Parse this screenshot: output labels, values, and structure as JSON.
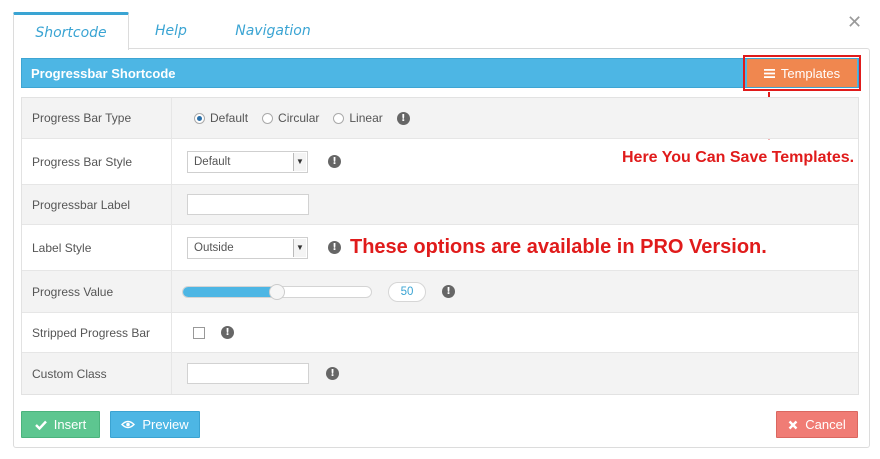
{
  "tabs": [
    {
      "label": "Shortcode",
      "active": true
    },
    {
      "label": "Help",
      "active": false
    },
    {
      "label": "Navigation",
      "active": false
    }
  ],
  "close_glyph": "✕",
  "header": {
    "title": "Progressbar Shortcode",
    "templates_label": "Templates"
  },
  "annotations": {
    "templates_note": "Here You Can Save Templates.",
    "pro_note": "These options are available in PRO Version."
  },
  "fields": {
    "type": {
      "label": "Progress Bar Type",
      "options": [
        "Default",
        "Circular",
        "Linear"
      ],
      "selected": "Default"
    },
    "style": {
      "label": "Progress Bar Style",
      "value": "Default"
    },
    "label": {
      "label": "Progressbar Label",
      "value": ""
    },
    "label_style": {
      "label": "Label Style",
      "value": "Outside"
    },
    "progress_value": {
      "label": "Progress Value",
      "value": "50",
      "fraction": 0.5
    },
    "striped": {
      "label": "Stripped Progress Bar",
      "checked": false
    },
    "custom_class": {
      "label": "Custom Class",
      "value": ""
    }
  },
  "buttons": {
    "insert": "Insert",
    "preview": "Preview",
    "cancel": "Cancel"
  },
  "colors": {
    "accent": "#4db6e4",
    "templates": "#f0874f",
    "insert": "#5dc690",
    "cancel": "#f07c75",
    "annotation": "#e01b1b"
  },
  "icons": [
    "menu-icon",
    "check-icon",
    "eye-icon",
    "cross-icon",
    "info-icon",
    "close-icon",
    "arrow-down-icon"
  ]
}
